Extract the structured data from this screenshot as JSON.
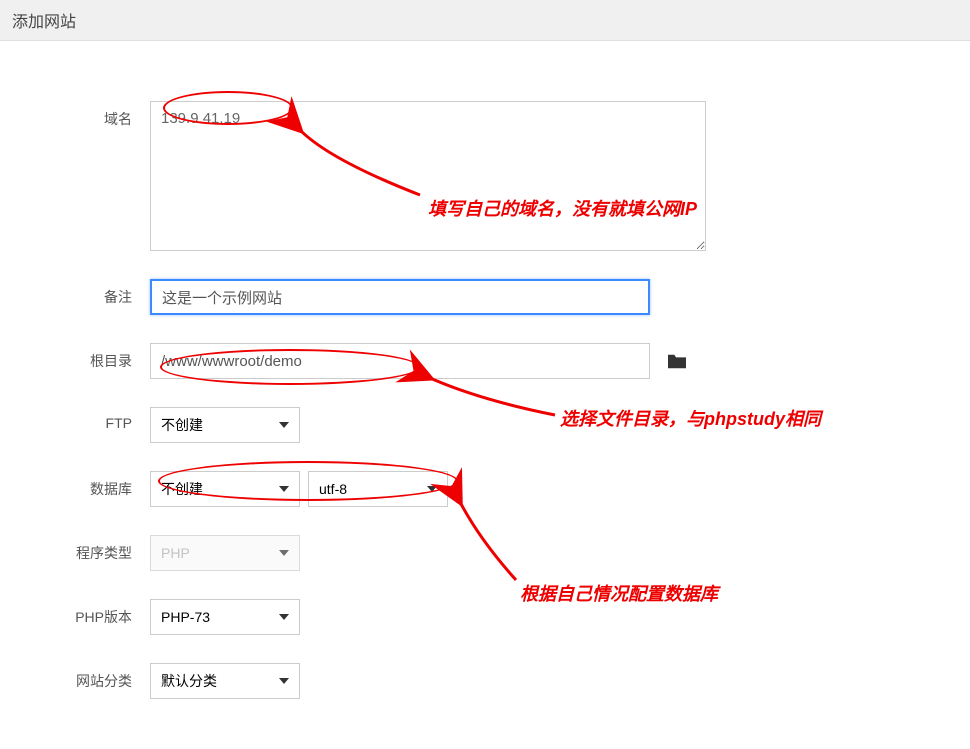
{
  "header": {
    "title": "添加网站"
  },
  "form": {
    "domain": {
      "label": "域名",
      "value": "139.9.41.19"
    },
    "remark": {
      "label": "备注",
      "value": "这是一个示例网站"
    },
    "root": {
      "label": "根目录",
      "value": "/www/wwwroot/demo"
    },
    "ftp": {
      "label": "FTP",
      "value": "不创建"
    },
    "db": {
      "label": "数据库",
      "value": "不创建",
      "charset": "utf-8"
    },
    "ptype": {
      "label": "程序类型",
      "value": "PHP"
    },
    "phpver": {
      "label": "PHP版本",
      "value": "PHP-73"
    },
    "category": {
      "label": "网站分类",
      "value": "默认分类"
    }
  },
  "annotations": {
    "a1": "填写自己的域名，没有就填公网IP",
    "a2": "选择文件目录，与phpstudy相同",
    "a3": "根据自己情况配置数据库"
  }
}
